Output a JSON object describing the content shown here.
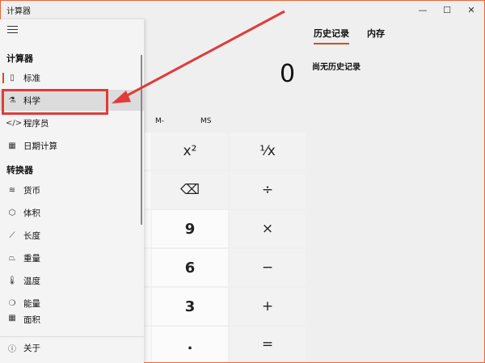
{
  "app": {
    "title": "计算器"
  },
  "window": {
    "minimize": "—",
    "maximize": "☐",
    "close": "✕"
  },
  "tabs": [
    {
      "label": "历史记录",
      "active": true
    },
    {
      "label": "内存",
      "active": false
    }
  ],
  "history": {
    "empty_text": "尚无历史记录"
  },
  "display": {
    "value": "0"
  },
  "memory": {
    "mminus": "M-",
    "ms": "MS"
  },
  "keypad": {
    "row1": {
      "square": "x²",
      "reciprocal": "⅟x"
    },
    "row2": {
      "backspace": "⌫",
      "divide": "÷"
    },
    "row3": {
      "nine": "9",
      "multiply": "×"
    },
    "row4": {
      "six": "6",
      "minus": "−"
    },
    "row5": {
      "three": "3",
      "plus": "+"
    },
    "row6": {
      "decimal": ".",
      "equals": "="
    }
  },
  "drawer": {
    "calculator_section": "计算器",
    "converter_section": "转换器",
    "items": [
      {
        "label": "标准",
        "icon": "▯"
      },
      {
        "label": "科学",
        "icon": "⚗"
      },
      {
        "label": "程序员",
        "icon": "</>"
      },
      {
        "label": "日期计算",
        "icon": "▦"
      }
    ],
    "converters": [
      {
        "label": "货币",
        "icon": "≋"
      },
      {
        "label": "体积",
        "icon": "⬡"
      },
      {
        "label": "长度",
        "icon": "⟋"
      },
      {
        "label": "重量",
        "icon": "⏢"
      },
      {
        "label": "温度",
        "icon": "🌡"
      },
      {
        "label": "能量",
        "icon": "❍"
      },
      {
        "label": "面积",
        "icon": "▦"
      }
    ],
    "about": {
      "label": "关于",
      "icon": "ⓘ"
    }
  },
  "colors": {
    "accent": "#c9521c",
    "annotation": "#e03b3b"
  }
}
